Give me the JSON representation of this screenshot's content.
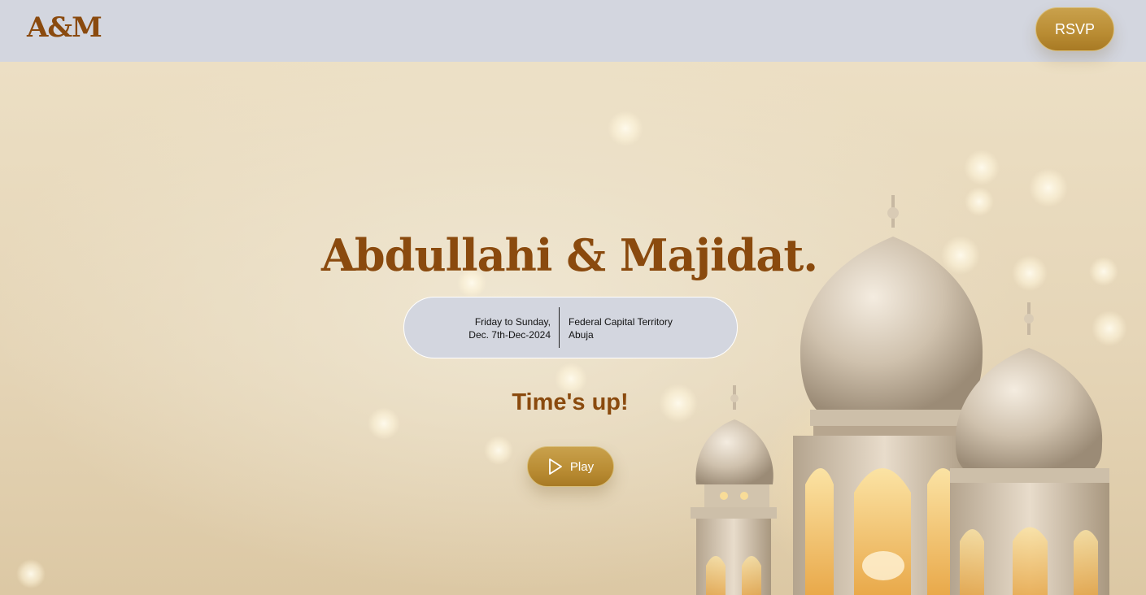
{
  "header": {
    "logo": "A&M",
    "rsvp_label": "RSVP"
  },
  "hero": {
    "names": "Abdullahi & Majidat.",
    "date_line1": "Friday to Sunday,",
    "date_line2": "Dec. 7th-Dec-2024",
    "location_line1": "Federal Capital Territory",
    "location_line2": "Abuja",
    "countdown_status": "Time's up!",
    "play_label": "Play",
    "play_icon": "play-icon",
    "background_image": "golden-lanterns-bokeh"
  },
  "colors": {
    "brand_brown": "#8a4a0e",
    "gold": "#b98c33",
    "header_bg": "#d3d6df",
    "cream": "#ecdfc4"
  }
}
